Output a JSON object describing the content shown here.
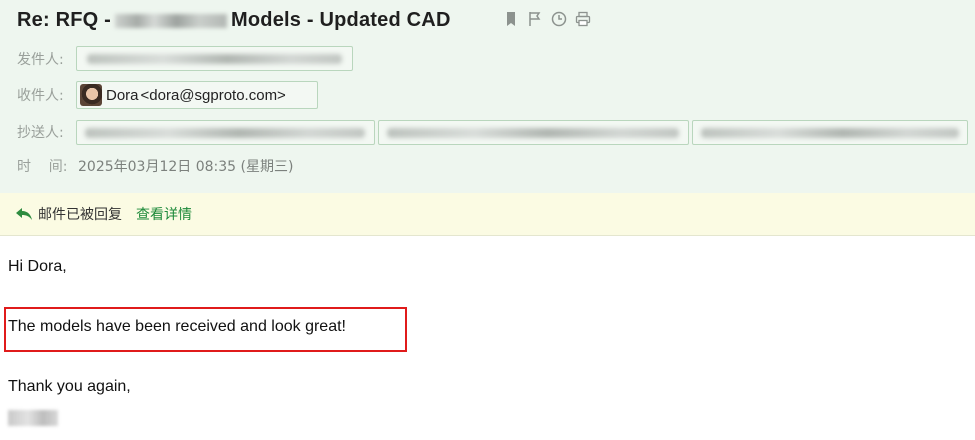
{
  "email": {
    "subject_prefix": "Re: RFQ - ",
    "subject_suffix": "Models - Updated CAD",
    "from_label": "发件人:",
    "to_label": "收件人:",
    "to_name": "Dora",
    "to_email": "<dora@sgproto.com>",
    "cc_label": "抄送人:",
    "time_label": "时    间:",
    "time_value": "2025年03月12日 08:35 (星期三)"
  },
  "notice": {
    "text": "邮件已被回复",
    "link": "查看详情"
  },
  "body": {
    "greeting": "Hi Dora,",
    "line1": "The models have been received and look great!",
    "closing": "Thank you again,"
  },
  "icons": {
    "bookmark": "bookmark-icon",
    "flag": "flag-icon",
    "clock": "clock-icon",
    "print": "print-icon",
    "reply": "reply-icon"
  },
  "colors": {
    "header_bg": "#eef6ef",
    "notice_bg": "#fbfbe3",
    "link": "#1d8a3a",
    "highlight": "#e01b1b"
  }
}
